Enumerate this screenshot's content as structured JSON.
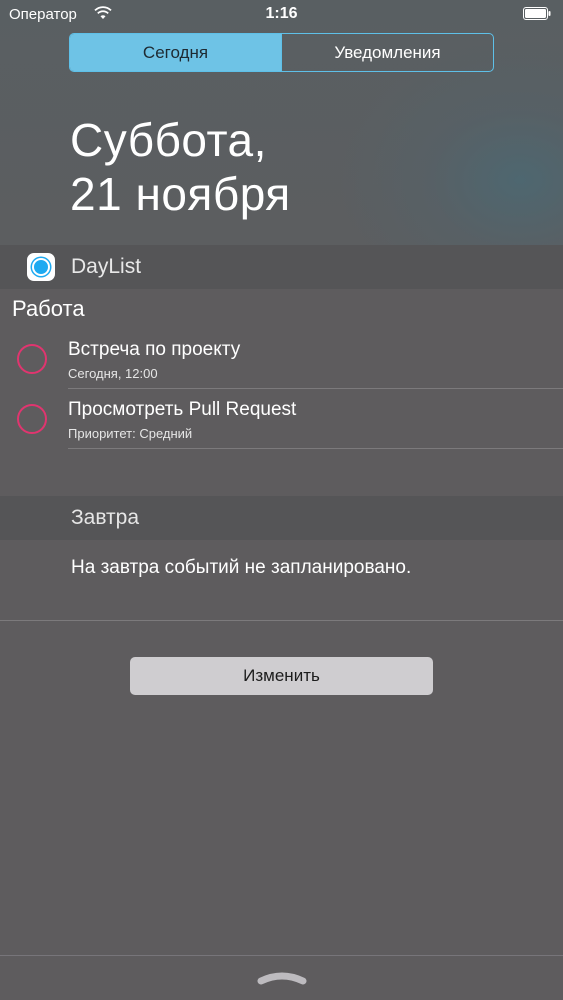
{
  "status_bar": {
    "carrier": "Оператор",
    "time": "1:16",
    "wifi_icon": "wifi-icon",
    "battery_icon": "battery-icon"
  },
  "tabs": [
    {
      "label": "Сегодня",
      "active": true
    },
    {
      "label": "Уведомления",
      "active": false
    }
  ],
  "date": {
    "line1": "Суббота,",
    "line2": "21 ноября"
  },
  "widget": {
    "app_name": "DayList",
    "app_icon": "daylist-app-icon",
    "section_title": "Работа",
    "tasks": [
      {
        "title": "Встреча по проекту",
        "subtitle": "Сегодня, 12:00"
      },
      {
        "title": "Просмотреть Pull Request",
        "subtitle": "Приоритет: Средний"
      }
    ],
    "tomorrow": {
      "title": "Завтра",
      "empty_text": "На завтра событий не запланировано."
    }
  },
  "edit_button_label": "Изменить",
  "colors": {
    "accent": "#6ec3e6",
    "task_circle": "#e0356f",
    "background": "#5e5c5e"
  }
}
